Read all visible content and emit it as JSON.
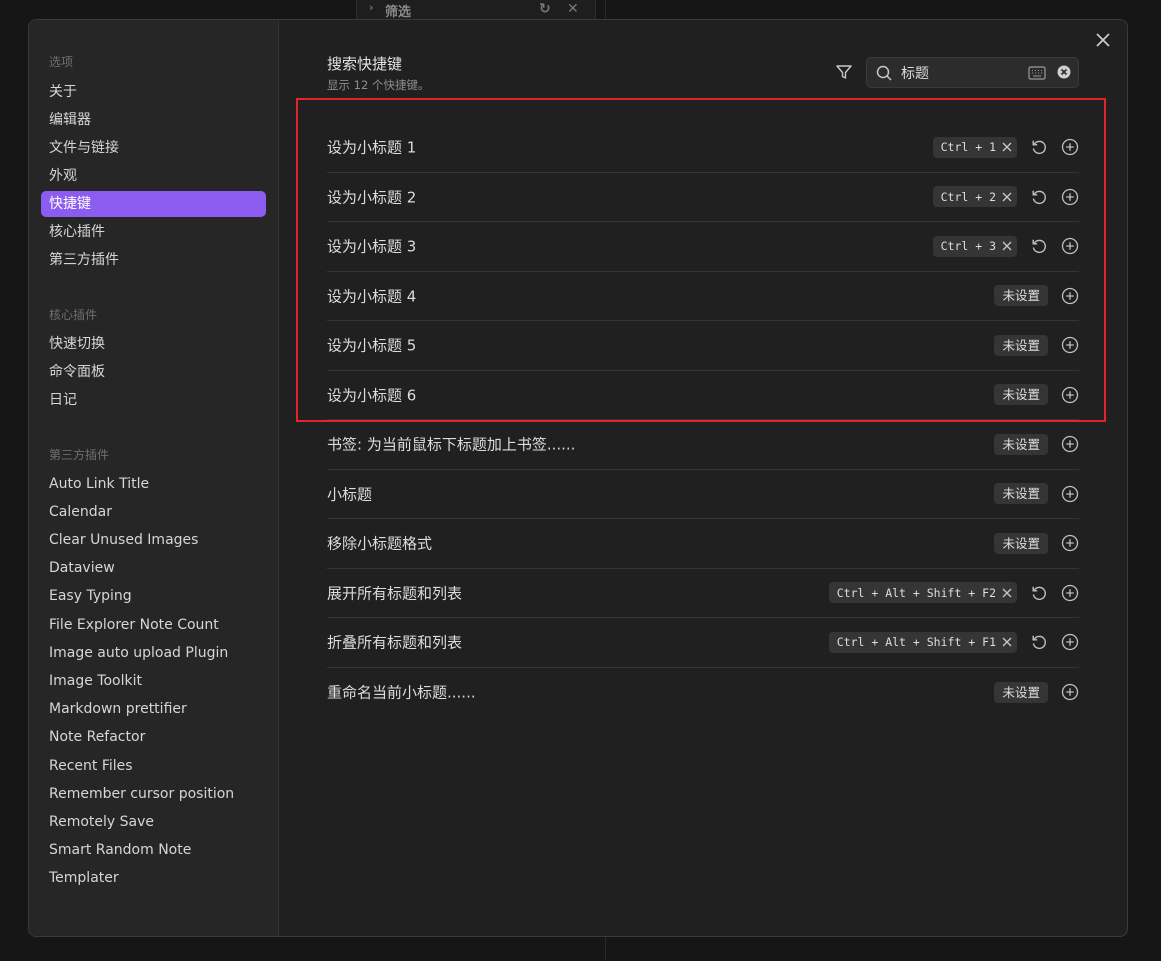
{
  "background": {
    "filter_label": "筛选"
  },
  "sidebar": {
    "sections": [
      {
        "heading": "选项",
        "items": [
          "关于",
          "编辑器",
          "文件与链接",
          "外观",
          "快捷键",
          "核心插件",
          "第三方插件"
        ]
      },
      {
        "heading": "核心插件",
        "items": [
          "快速切换",
          "命令面板",
          "日记"
        ]
      },
      {
        "heading": "第三方插件",
        "items": [
          "Auto Link Title",
          "Calendar",
          "Clear Unused Images",
          "Dataview",
          "Easy Typing",
          "File Explorer Note Count",
          "Image auto upload Plugin",
          "Image Toolkit",
          "Markdown prettifier",
          "Note Refactor",
          "Recent Files",
          "Remember cursor position",
          "Remotely Save",
          "Smart Random Note",
          "Templater"
        ]
      }
    ],
    "active_item": "快捷键"
  },
  "header": {
    "title": "搜索快捷键",
    "subtitle": "显示 12 个快捷键。"
  },
  "search": {
    "value": "标题"
  },
  "unset_label": "未设置",
  "hotkeys": [
    {
      "label": "设为小标题 1",
      "hotkey": "Ctrl + 1"
    },
    {
      "label": "设为小标题 2",
      "hotkey": "Ctrl + 2"
    },
    {
      "label": "设为小标题 3",
      "hotkey": "Ctrl + 3"
    },
    {
      "label": "设为小标题 4",
      "hotkey": null
    },
    {
      "label": "设为小标题 5",
      "hotkey": null
    },
    {
      "label": "设为小标题 6",
      "hotkey": null
    },
    {
      "label": "书签: 为当前鼠标下标题加上书签......",
      "hotkey": null
    },
    {
      "label": "小标题",
      "hotkey": null
    },
    {
      "label": "移除小标题格式",
      "hotkey": null
    },
    {
      "label": "展开所有标题和列表",
      "hotkey": "Ctrl + Alt + Shift + F2"
    },
    {
      "label": "折叠所有标题和列表",
      "hotkey": "Ctrl + Alt + Shift + F1"
    },
    {
      "label": "重命名当前小标题......",
      "hotkey": null
    }
  ],
  "colors": {
    "accent": "#8c5cf0",
    "highlight_box": "#e0262c"
  }
}
